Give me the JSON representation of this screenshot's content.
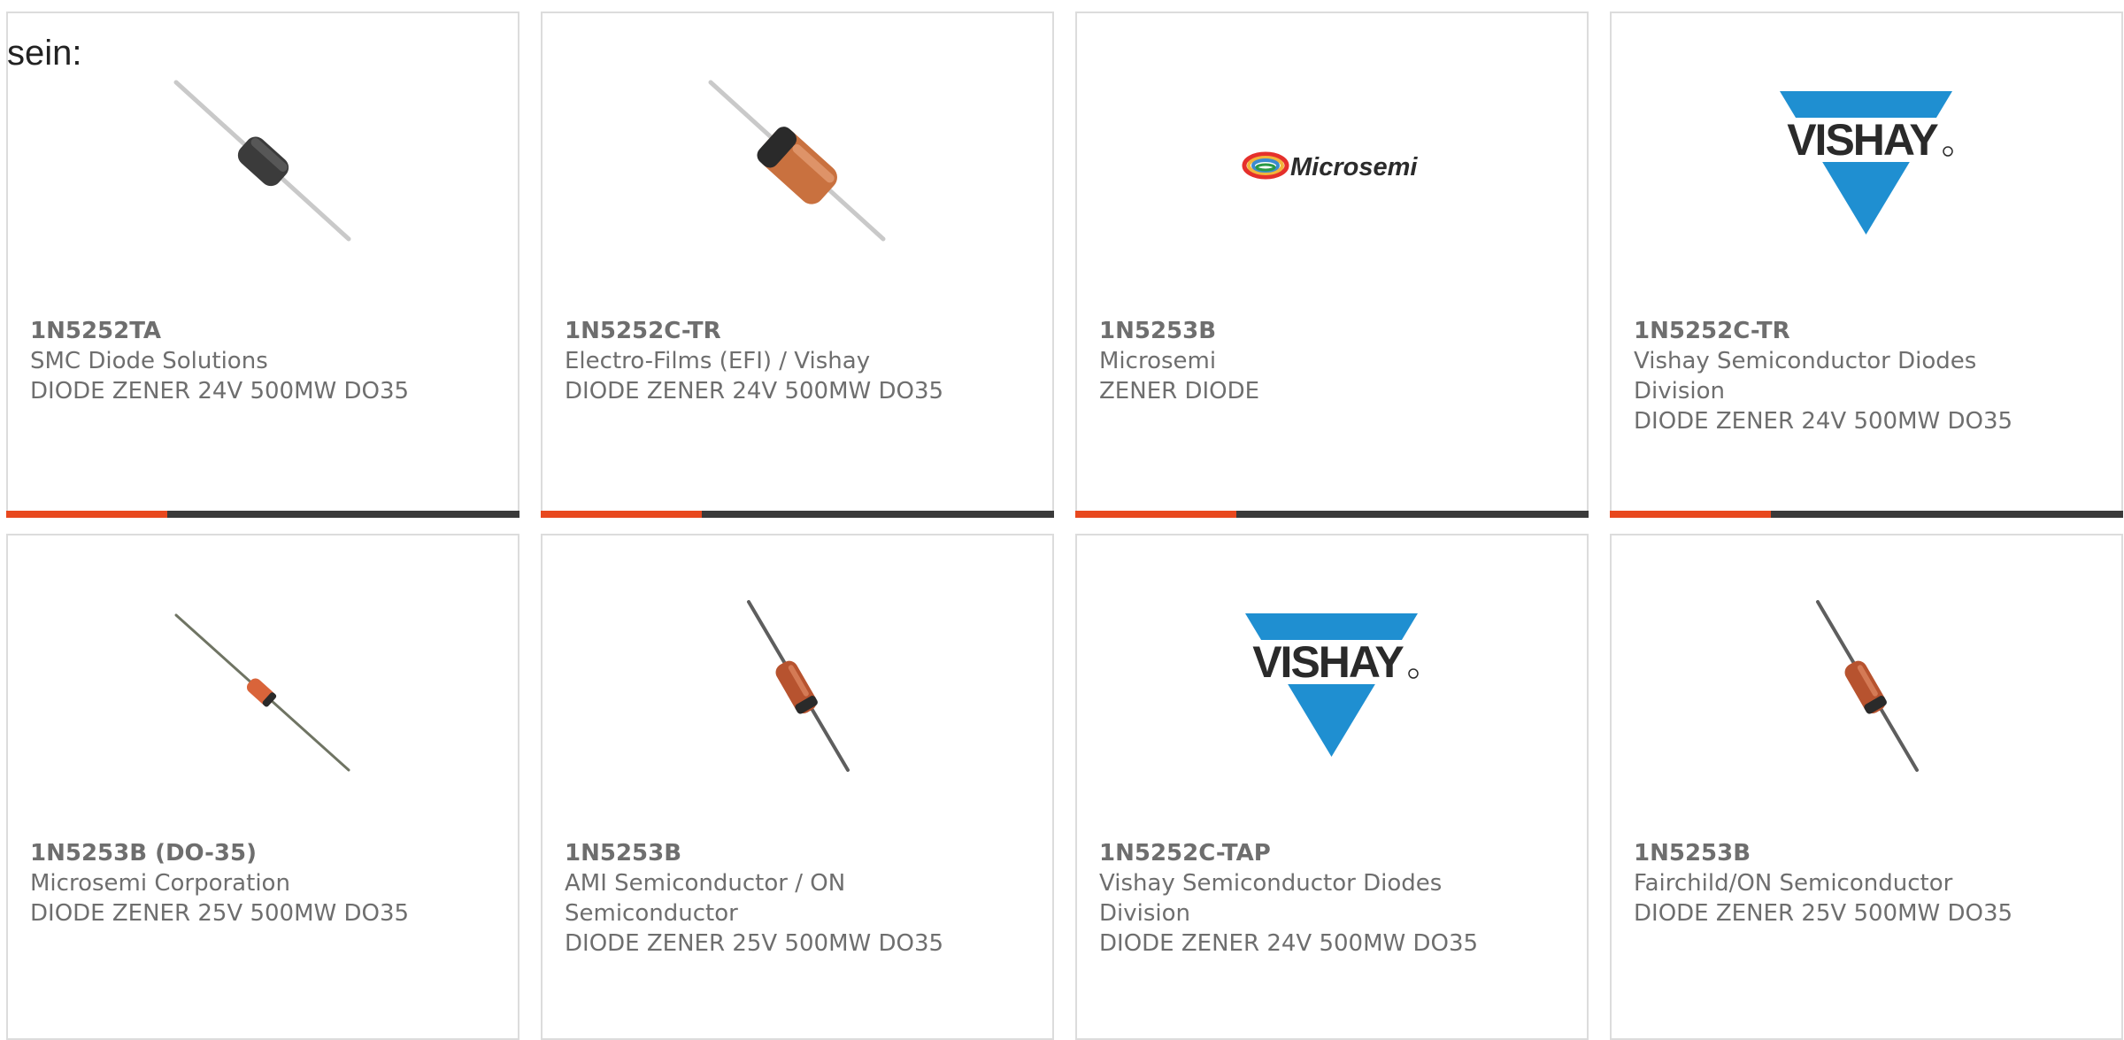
{
  "intro_text": "sein:",
  "colors": {
    "card_border": "#dcdcdc",
    "bar_dark": "#3a3a3a",
    "bar_accent": "#e8481e",
    "text": "#6e6e6e",
    "vishay_blue": "#1f8fd1"
  },
  "products": [
    {
      "part": "1N5252TA",
      "manufacturer": "SMC Diode Solutions",
      "description": "DIODE ZENER 24V 500MW DO35",
      "image": "diode-black-band-icon"
    },
    {
      "part": "1N5252C-TR",
      "manufacturer": "Electro-Films (EFI) / Vishay",
      "description": "DIODE ZENER 24V 500MW DO35",
      "image": "diode-orange-glass-icon"
    },
    {
      "part": "1N5253B",
      "manufacturer": "Microsemi",
      "description": "ZENER DIODE",
      "image": "microsemi-logo",
      "logo_text": "Microsemi"
    },
    {
      "part": "1N5252C-TR",
      "manufacturer": "Vishay Semiconductor Diodes Division",
      "description": "DIODE ZENER 24V 500MW DO35",
      "image": "vishay-logo",
      "logo_text": "VISHAY"
    },
    {
      "part": "1N5253B (DO-35)",
      "manufacturer": "Microsemi Corporation",
      "description": "DIODE ZENER 25V 500MW DO35",
      "image": "diode-small-red-icon"
    },
    {
      "part": "1N5253B",
      "manufacturer": "AMI Semiconductor / ON Semiconductor",
      "description": "DIODE ZENER 25V 500MW DO35",
      "image": "diode-red-glass-icon"
    },
    {
      "part": "1N5252C-TAP",
      "manufacturer": "Vishay Semiconductor Diodes Division",
      "description": "DIODE ZENER 24V 500MW DO35",
      "image": "vishay-logo",
      "logo_text": "VISHAY"
    },
    {
      "part": "1N5253B",
      "manufacturer": "Fairchild/ON Semiconductor",
      "description": "DIODE ZENER 25V 500MW DO35",
      "image": "diode-red-glass-icon"
    }
  ]
}
